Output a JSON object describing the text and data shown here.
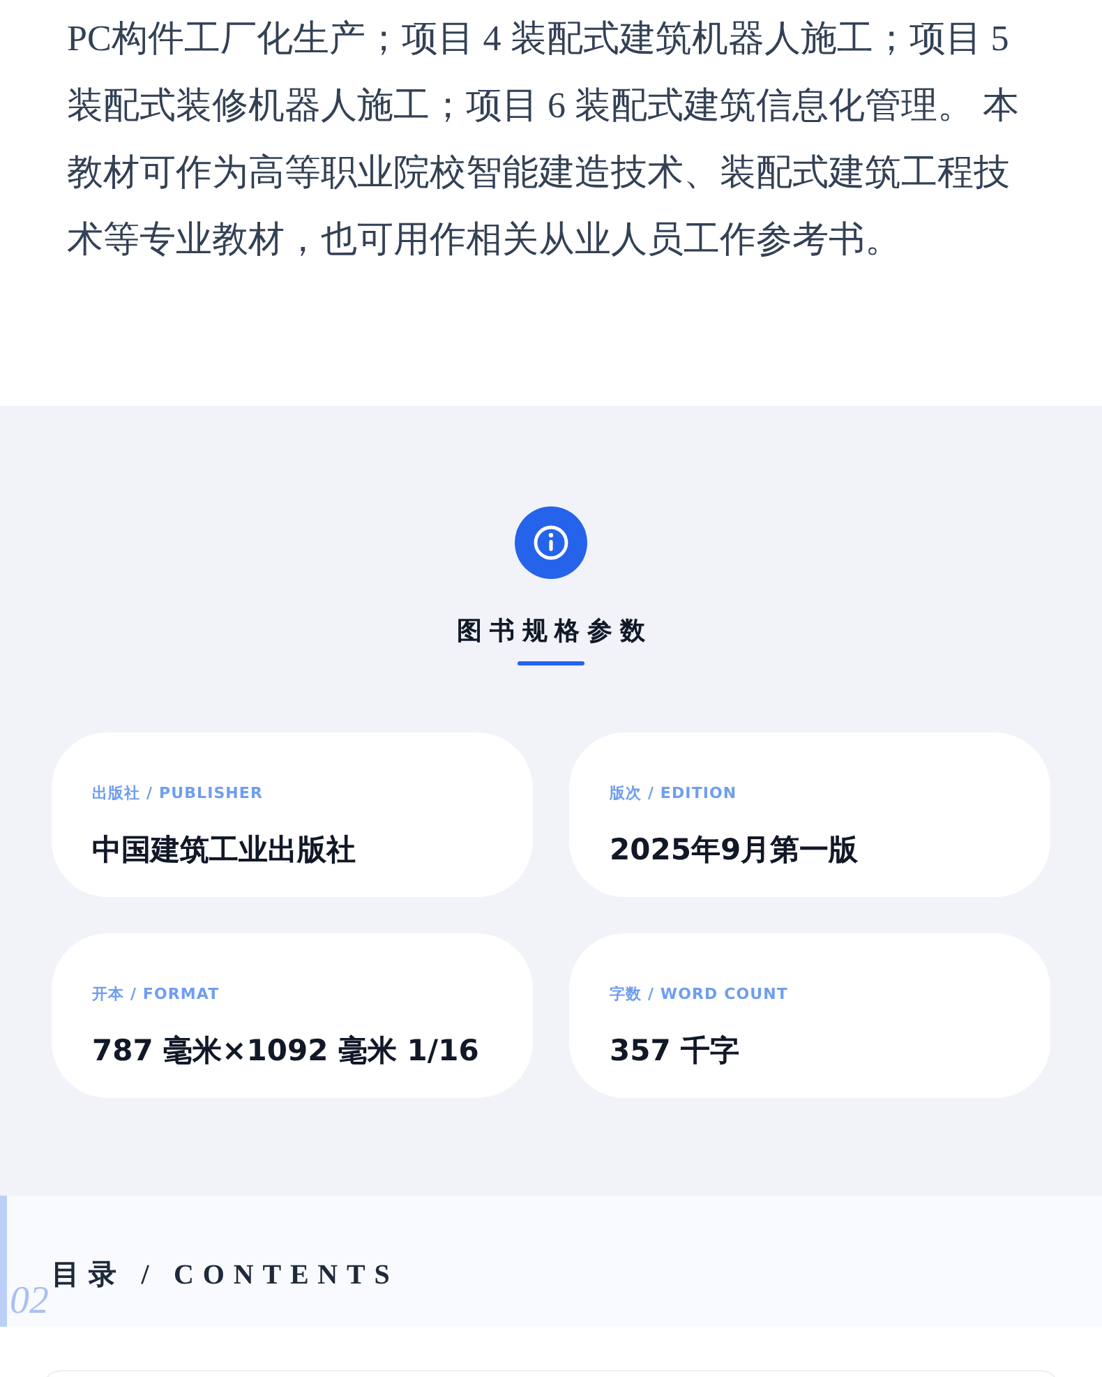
{
  "description": {
    "text": "PC构件工厂化生产；项目 4 装配式建筑机器人施工；项目 5 装配式装修机器人施工；项目 6 装配式建筑信息化管理。 本教材可作为高等职业院校智能建造技术、装配式建筑工程技术等专业教材，也可用作相关从业人员工作参考书。"
  },
  "specs": {
    "title": "图书规格参数",
    "items": [
      {
        "label": "出版社 / PUBLISHER",
        "value": "中国建筑工业出版社"
      },
      {
        "label": "版次 / EDITION",
        "value": "2025年9月第一版"
      },
      {
        "label": "开本 / FORMAT",
        "value": "787 毫米×1092 毫米 1/16"
      },
      {
        "label": "字数 / WORD COUNT",
        "value": "357 千字"
      }
    ]
  },
  "contents": {
    "number": "02",
    "title": "目录 / CONTENTS"
  }
}
